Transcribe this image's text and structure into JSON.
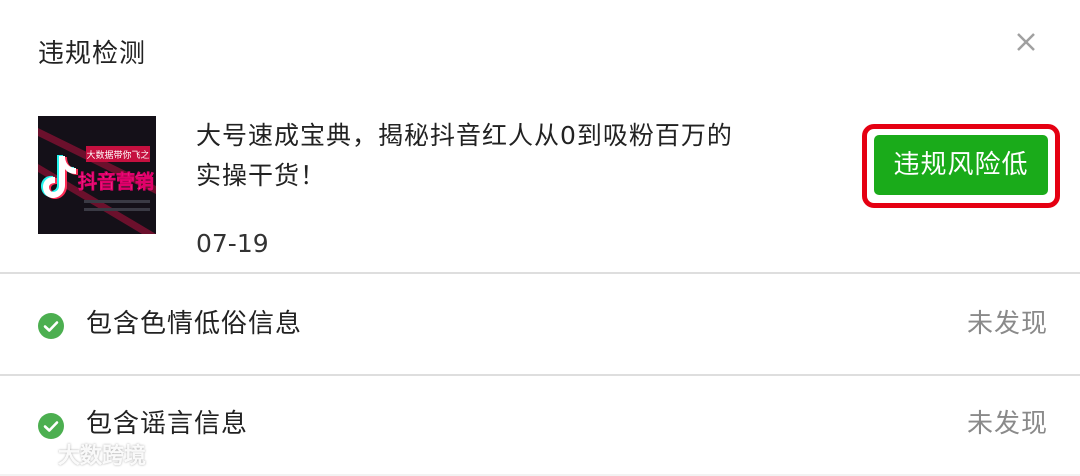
{
  "dialog": {
    "title": "违规检测",
    "close_icon": "close-icon"
  },
  "article": {
    "thumbnail": {
      "text_top": "大数据带你飞之",
      "text_main": "抖音营销",
      "icon": "tiktok-logo-icon"
    },
    "title_line1": "大号速成宝典，揭秘抖音红人从0到吸粉百万的",
    "title_line2": "实操干货！",
    "date": "07-19",
    "risk_label": "违规风险低"
  },
  "checks": [
    {
      "label": "包含色情低俗信息",
      "status": "未发现",
      "icon": "check-circle-icon"
    },
    {
      "label": "包含谣言信息",
      "status": "未发现",
      "icon": "check-circle-icon"
    }
  ],
  "watermark": {
    "text": "大数跨境"
  },
  "colors": {
    "accent_green": "#1aab1a",
    "highlight_red": "#e50012",
    "check_green": "#4caf50"
  }
}
